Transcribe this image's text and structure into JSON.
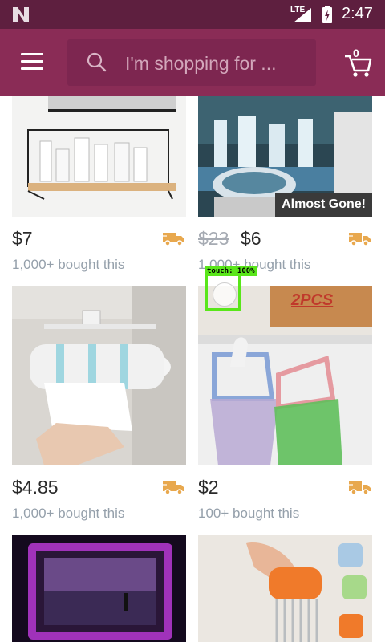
{
  "status_bar": {
    "network": "LTE",
    "time": "2:47"
  },
  "header": {
    "search_placeholder": "I'm shopping for ...",
    "cart_count": "0"
  },
  "products": [
    {
      "price": "$7",
      "bought": "1,000+ bought this"
    },
    {
      "old_price": "$23",
      "price": "$6",
      "bought": "1,000+ bought this",
      "badge": "Almost Gone!"
    },
    {
      "price": "$4.85",
      "bought": "1,000+ bought this"
    },
    {
      "price": "$2",
      "bought": "100+ bought this",
      "image_text": "2PCS"
    },
    {},
    {}
  ],
  "overlay": {
    "touch_label": "touch: 100%"
  },
  "colors": {
    "status_bar": "#5e1f3f",
    "header": "#8a2c56",
    "search_box": "#7d2650",
    "shipping_icon": "#e8a84e",
    "secondary_text": "#95a0ab",
    "touch_indicator": "#59e61a"
  },
  "icons": {
    "app_logo": "app-logo-icon",
    "signal": "signal-icon",
    "battery": "battery-charging-icon",
    "menu": "hamburger-menu-icon",
    "search": "search-icon",
    "cart": "cart-icon",
    "shipping": "truck-shipping-icon"
  }
}
